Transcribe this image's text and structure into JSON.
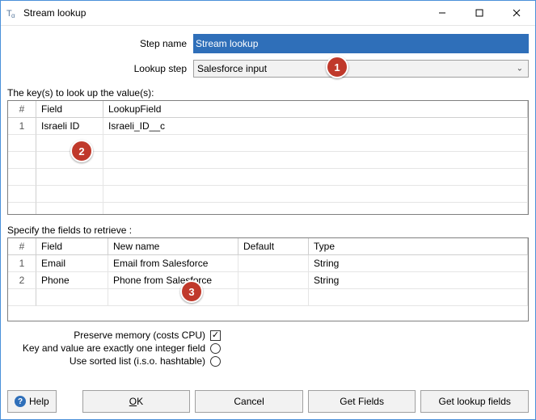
{
  "window": {
    "title": "Stream lookup"
  },
  "form": {
    "step_name_label": "Step name",
    "step_name_value": "Stream lookup",
    "lookup_step_label": "Lookup step",
    "lookup_step_value": "Salesforce input"
  },
  "keys_section": {
    "heading": "The key(s) to look up the value(s):",
    "columns": {
      "num": "#",
      "field": "Field",
      "lookup": "LookupField"
    },
    "rows": [
      {
        "num": "1",
        "field": "Israeli ID",
        "lookup": "Israeli_ID__c"
      }
    ]
  },
  "retrieve_section": {
    "heading": "Specify the fields to retrieve :",
    "columns": {
      "num": "#",
      "field": "Field",
      "newname": "New name",
      "def": "Default",
      "type": "Type"
    },
    "rows": [
      {
        "num": "1",
        "field": "Email",
        "newname": "Email from Salesforce",
        "def": "",
        "type": "String"
      },
      {
        "num": "2",
        "field": "Phone",
        "newname": "Phone from Salesforce",
        "def": "",
        "type": "String"
      }
    ]
  },
  "options": {
    "preserve_memory_label": "Preserve memory (costs CPU)",
    "preserve_memory_checked": true,
    "one_integer_label": "Key and value are exactly one integer field",
    "one_integer_checked": false,
    "sorted_list_label": "Use sorted list (i.s.o. hashtable)",
    "sorted_list_checked": false
  },
  "buttons": {
    "help": "Help",
    "ok": "OK",
    "cancel": "Cancel",
    "get_fields": "Get Fields",
    "get_lookup_fields": "Get lookup fields"
  },
  "callouts": {
    "c1": "1",
    "c2": "2",
    "c3": "3"
  }
}
